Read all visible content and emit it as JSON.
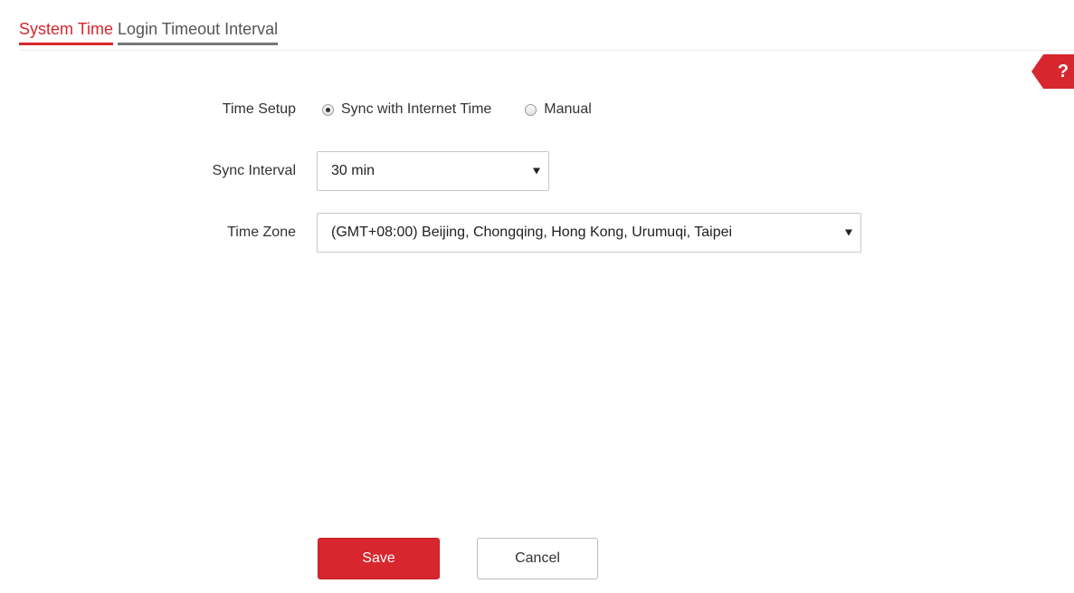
{
  "tabs": [
    {
      "label": "System Time",
      "active": true
    },
    {
      "label": "Login Timeout Interval",
      "active": false
    }
  ],
  "help": {
    "label": "?",
    "icon": "help-icon"
  },
  "form": {
    "time_setup": {
      "label": "Time Setup",
      "options": [
        {
          "label": "Sync with Internet Time",
          "selected": true
        },
        {
          "label": "Manual",
          "selected": false
        }
      ]
    },
    "sync_interval": {
      "label": "Sync Interval",
      "value": "30 min"
    },
    "time_zone": {
      "label": "Time Zone",
      "value": "(GMT+08:00) Beijing, Chongqing, Hong Kong, Urumuqi, Taipei"
    }
  },
  "actions": {
    "save_label": "Save",
    "cancel_label": "Cancel"
  },
  "colors": {
    "accent": "#d7262e",
    "tab_inactive_underline": "#777777"
  }
}
